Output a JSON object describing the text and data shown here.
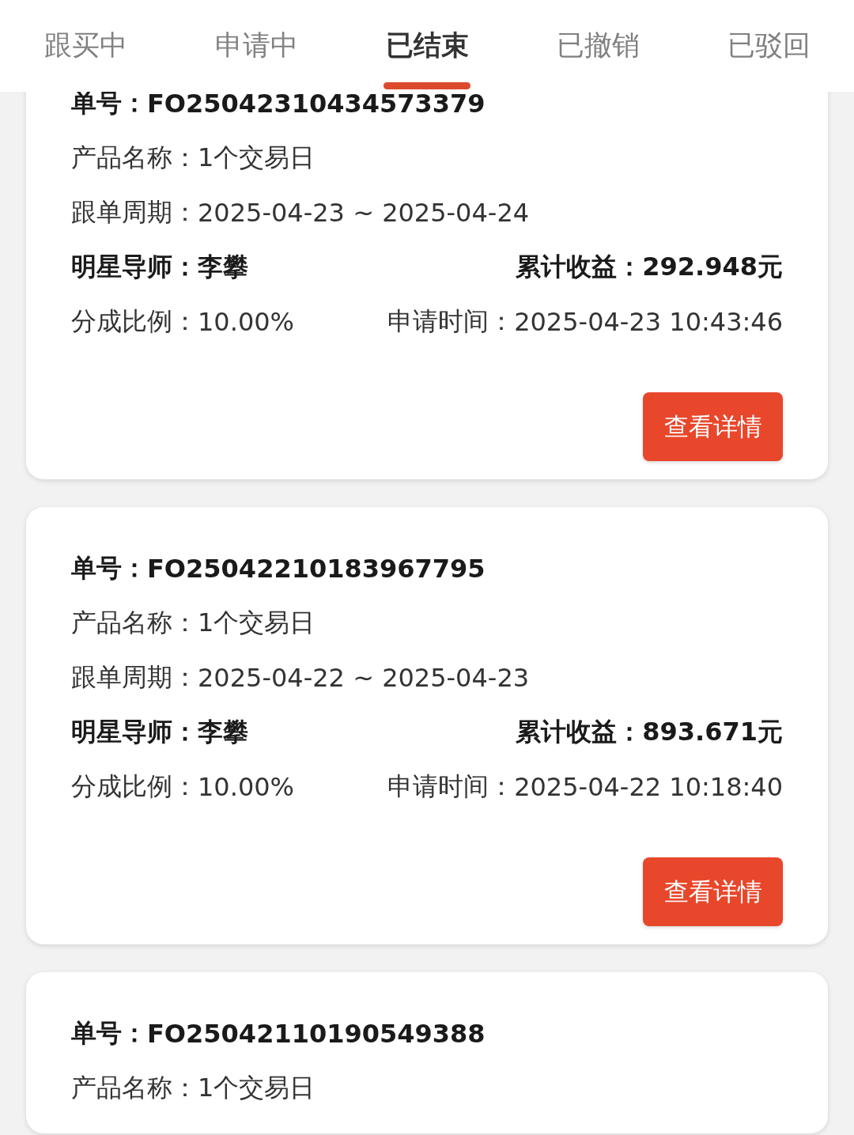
{
  "tabs": [
    {
      "label": "跟买中",
      "selected": false
    },
    {
      "label": "申请中",
      "selected": false
    },
    {
      "label": "已结束",
      "selected": true
    },
    {
      "label": "已撤销",
      "selected": false
    },
    {
      "label": "已驳回",
      "selected": false
    }
  ],
  "orders": [
    {
      "order_no": {
        "label": "单号：",
        "value": "FO25042310434573379"
      },
      "product": {
        "label": "产品名称：",
        "value": "1个交易日"
      },
      "period": {
        "label": "跟单周期：",
        "value": "2025-04-23 ~ 2025-04-24"
      },
      "mentor": {
        "label": "明星导师：",
        "value": "李攀"
      },
      "earnings": {
        "label": "累计收益：",
        "value": "292.948元"
      },
      "ratio": {
        "label": "分成比例：",
        "value": "10.00%"
      },
      "apply_time": {
        "label": "申请时间：",
        "value": "2025-04-23 10:43:46"
      },
      "button": "查看详情"
    },
    {
      "order_no": {
        "label": "单号：",
        "value": "FO25042210183967795"
      },
      "product": {
        "label": "产品名称：",
        "value": "1个交易日"
      },
      "period": {
        "label": "跟单周期：",
        "value": "2025-04-22 ~ 2025-04-23"
      },
      "mentor": {
        "label": "明星导师：",
        "value": "李攀"
      },
      "earnings": {
        "label": "累计收益：",
        "value": "893.671元"
      },
      "ratio": {
        "label": "分成比例：",
        "value": "10.00%"
      },
      "apply_time": {
        "label": "申请时间：",
        "value": "2025-04-22 10:18:40"
      },
      "button": "查看详情"
    },
    {
      "order_no": {
        "label": "单号：",
        "value": "FO25042110190549388"
      },
      "product": {
        "label": "产品名称：",
        "value": "1个交易日"
      }
    }
  ]
}
